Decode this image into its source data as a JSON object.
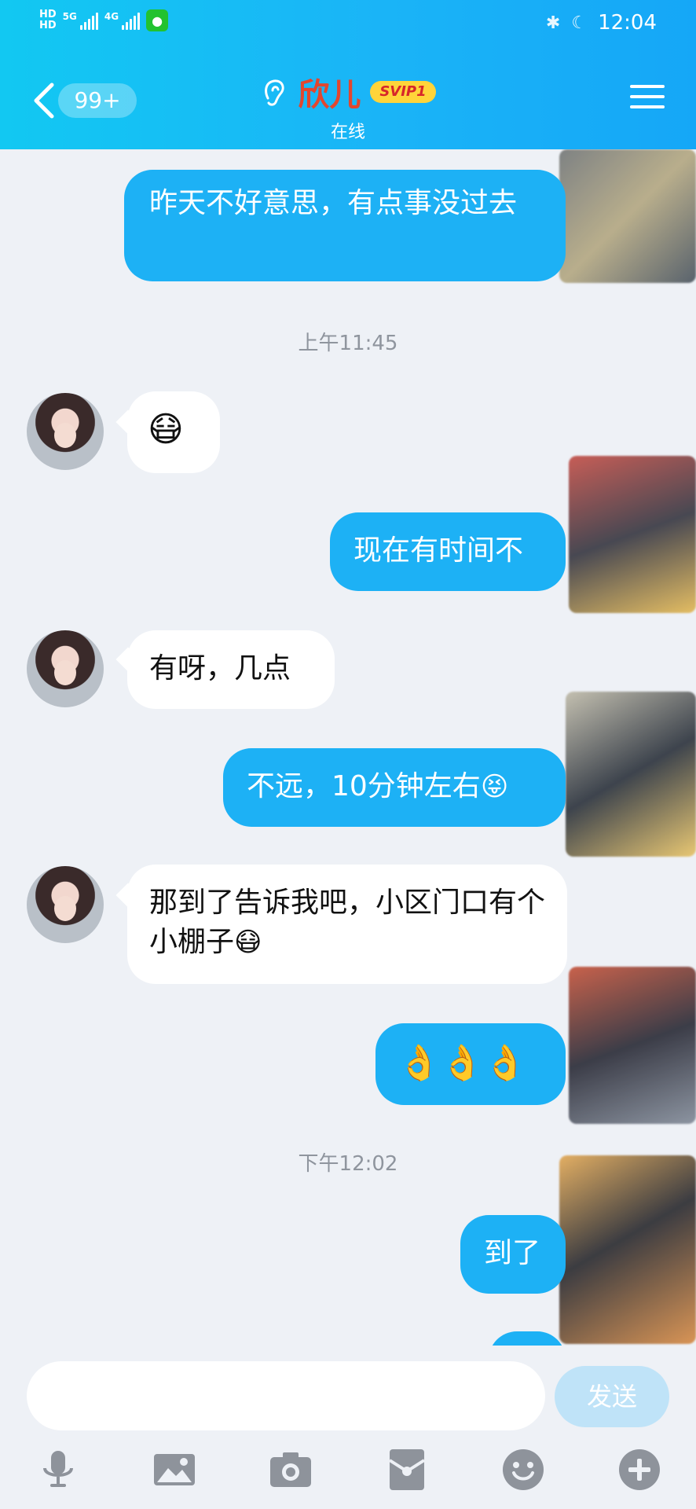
{
  "status_bar": {
    "hd1": "HD",
    "hd2": "HD",
    "net1": "5G",
    "net2": "4G",
    "time": "12:04"
  },
  "header": {
    "unread_count": "99+",
    "contact_name": "欣儿",
    "vip_badge": "SVIP1",
    "contact_status": "在线"
  },
  "messages": [
    {
      "side": "out",
      "text": "昨天不好意思，有点事没过去"
    },
    {
      "side": "timestamp",
      "text": "上午11:45"
    },
    {
      "side": "in",
      "text": "😷"
    },
    {
      "side": "out",
      "text": "现在有时间不"
    },
    {
      "side": "in",
      "text": "有呀，几点"
    },
    {
      "side": "out",
      "text": "不远，10分钟左右",
      "emoji": "😝"
    },
    {
      "side": "in",
      "text": "那到了告诉我吧，小区门口有个小棚子",
      "emoji": "😷"
    },
    {
      "side": "out",
      "text": "👌👌👌"
    },
    {
      "side": "timestamp",
      "text": "下午12:02"
    },
    {
      "side": "out",
      "text": "到了"
    }
  ],
  "composer": {
    "input_value": "",
    "send_label": "发送"
  },
  "toolbar_icons": [
    "microphone-icon",
    "image-icon",
    "camera-icon",
    "red-packet-icon",
    "emoji-icon",
    "plus-icon"
  ],
  "colors": {
    "header": "#1ab4f7",
    "outgoing_bubble": "#1db1f5",
    "incoming_bubble": "#ffffff",
    "name": "#e2462e",
    "background": "#eef1f6"
  }
}
